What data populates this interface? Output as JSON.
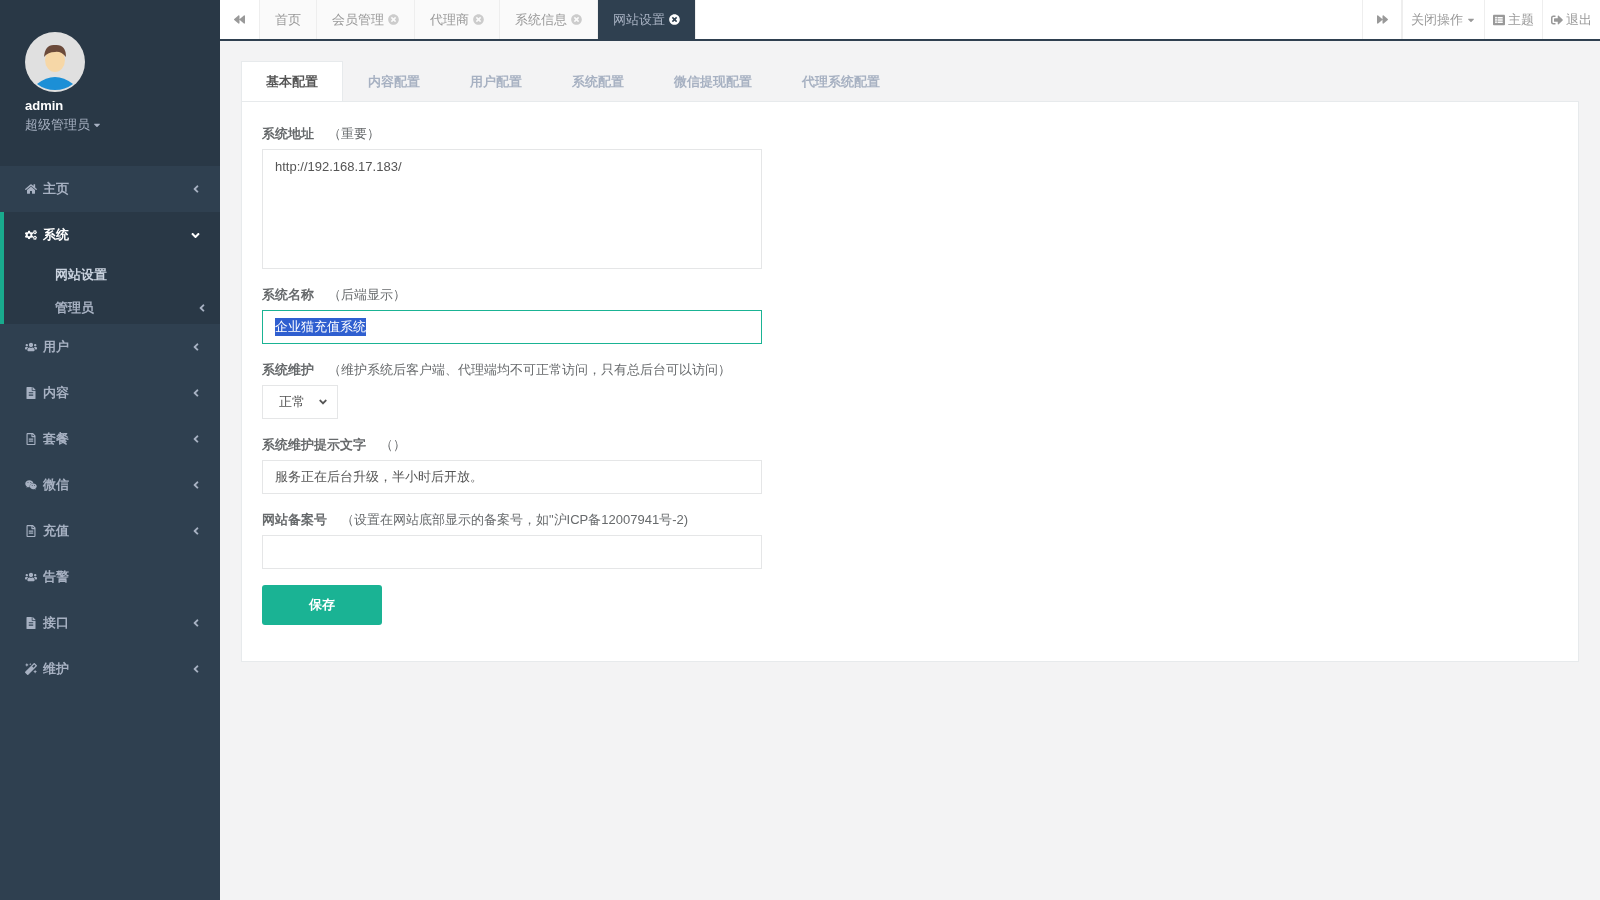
{
  "user": {
    "name": "admin",
    "role": "超级管理员"
  },
  "nav": [
    {
      "label": "主页",
      "expanded": false,
      "selected": false
    },
    {
      "label": "系统",
      "expanded": true,
      "selected": true,
      "children": [
        {
          "label": "网站设置",
          "selected": true
        },
        {
          "label": "管理员",
          "selected": false
        }
      ]
    },
    {
      "label": "用户",
      "expanded": false,
      "selected": false
    },
    {
      "label": "内容",
      "expanded": false,
      "selected": false
    },
    {
      "label": "套餐",
      "expanded": false,
      "selected": false
    },
    {
      "label": "微信",
      "expanded": false,
      "selected": false
    },
    {
      "label": "充值",
      "expanded": false,
      "selected": false
    },
    {
      "label": "告警",
      "expanded": false,
      "selected": false
    },
    {
      "label": "接口",
      "expanded": false,
      "selected": false
    },
    {
      "label": "维护",
      "expanded": false,
      "selected": false
    }
  ],
  "page_tabs": [
    {
      "label": "首页",
      "selected": false
    },
    {
      "label": "会员管理",
      "selected": false
    },
    {
      "label": "代理商",
      "selected": false
    },
    {
      "label": "系统信息",
      "selected": false
    },
    {
      "label": "网站设置",
      "selected": true
    }
  ],
  "top_actions": [
    "关闭操作",
    "主题",
    "退出"
  ],
  "config_tabs": [
    {
      "label": "基本配置",
      "selected": true
    },
    {
      "label": "内容配置",
      "selected": false
    },
    {
      "label": "用户配置",
      "selected": false
    },
    {
      "label": "系统配置",
      "selected": false
    },
    {
      "label": "微信提现配置",
      "selected": false
    },
    {
      "label": "代理系统配置",
      "selected": false
    }
  ],
  "fields": [
    {
      "kind": "textarea",
      "label": "系统地址",
      "hint": "（重要）",
      "value": "http://192.168.17.183/",
      "focused": false
    },
    {
      "kind": "input",
      "label": "系统名称",
      "hint": "（后端显示）",
      "value": "企业猫充值系统",
      "focused": true,
      "text_selected": true
    },
    {
      "kind": "select",
      "label": "系统维护",
      "hint": "（维护系统后客户端、代理端均不可正常访问，只有总后台可以访问）",
      "value": "正常"
    },
    {
      "kind": "input",
      "label": "系统维护提示文字",
      "hint": "（）",
      "value": "服务正在后台升级，半小时后开放。",
      "focused": false
    },
    {
      "kind": "input",
      "label": "网站备案号",
      "hint": "（设置在网站底部显示的备案号，如\"沪ICP备12007941号-2)",
      "focused": false
    }
  ],
  "save_button": "保存"
}
